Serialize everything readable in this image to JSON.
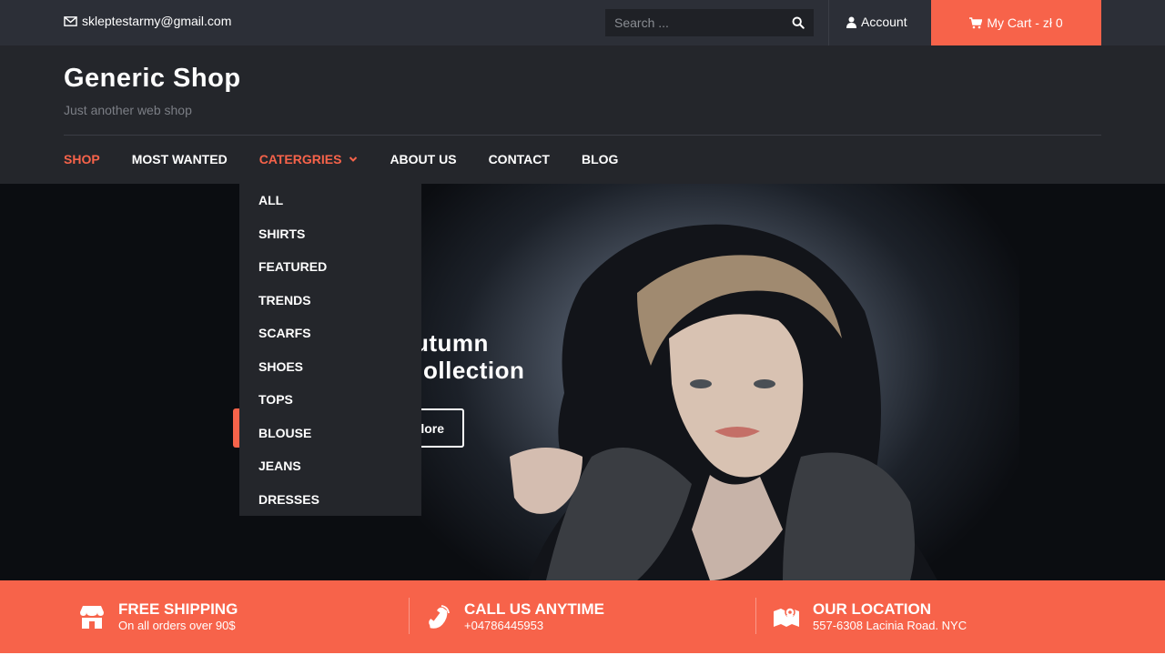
{
  "topbar": {
    "email": "skleptestarmy@gmail.com",
    "search_placeholder": "Search ...",
    "account_label": "Account",
    "cart_label": "My Cart - zł 0"
  },
  "header": {
    "site_title": "Generic Shop",
    "tagline": "Just another web shop"
  },
  "nav": {
    "items": [
      {
        "label": "Shop",
        "active": true
      },
      {
        "label": "Most Wanted",
        "active": false
      },
      {
        "label": "Catergries",
        "active": true,
        "has_dropdown": true
      },
      {
        "label": "About Us",
        "active": false
      },
      {
        "label": "Contact",
        "active": false
      },
      {
        "label": "Blog",
        "active": false
      }
    ]
  },
  "dropdown": {
    "items": [
      "All",
      "Shirts",
      "Featured",
      "Trends",
      "Scarfs",
      "Shoes",
      "Tops",
      "Blouse",
      "Jeans",
      "Dresses"
    ]
  },
  "hero": {
    "heading_line1": "utumn",
    "heading_line2": "ollection",
    "button2_label": "lore"
  },
  "features": [
    {
      "icon": "store-icon",
      "title": "Free Shipping",
      "subtitle": "On all orders over 90$"
    },
    {
      "icon": "phone-icon",
      "title": "Call Us Anytime",
      "subtitle": "+04786445953"
    },
    {
      "icon": "map-icon",
      "title": "Our Location",
      "subtitle": "557-6308 Lacinia Road. NYC"
    }
  ],
  "colors": {
    "accent": "#f7634a",
    "topbar_bg": "#2c2f37",
    "header_bg": "#24262b"
  }
}
